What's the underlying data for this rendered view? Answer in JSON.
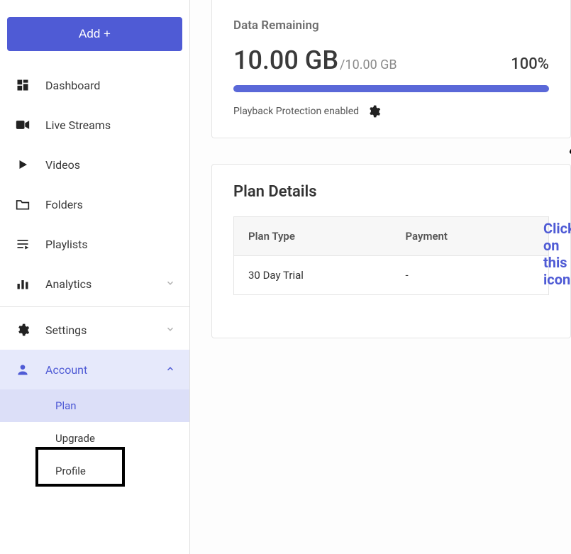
{
  "sidebar": {
    "add_label": "Add +",
    "items": [
      {
        "label": "Dashboard"
      },
      {
        "label": "Live Streams"
      },
      {
        "label": "Videos"
      },
      {
        "label": "Folders"
      },
      {
        "label": "Playlists"
      },
      {
        "label": "Analytics"
      },
      {
        "label": "Settings"
      },
      {
        "label": "Account"
      }
    ],
    "account_sub": [
      {
        "label": "Plan"
      },
      {
        "label": "Upgrade"
      },
      {
        "label": "Profile"
      }
    ]
  },
  "data_remaining": {
    "title": "Data Remaining",
    "used": "10.00 GB",
    "total": "/10.00 GB",
    "percent": "100%",
    "playback_label": "Playback Protection enabled"
  },
  "plan_details": {
    "title": "Plan Details",
    "columns": [
      "Plan Type",
      "Payment"
    ],
    "row": [
      "30 Day Trial",
      "-"
    ]
  },
  "annotation": {
    "callout": "Click on this icon"
  }
}
